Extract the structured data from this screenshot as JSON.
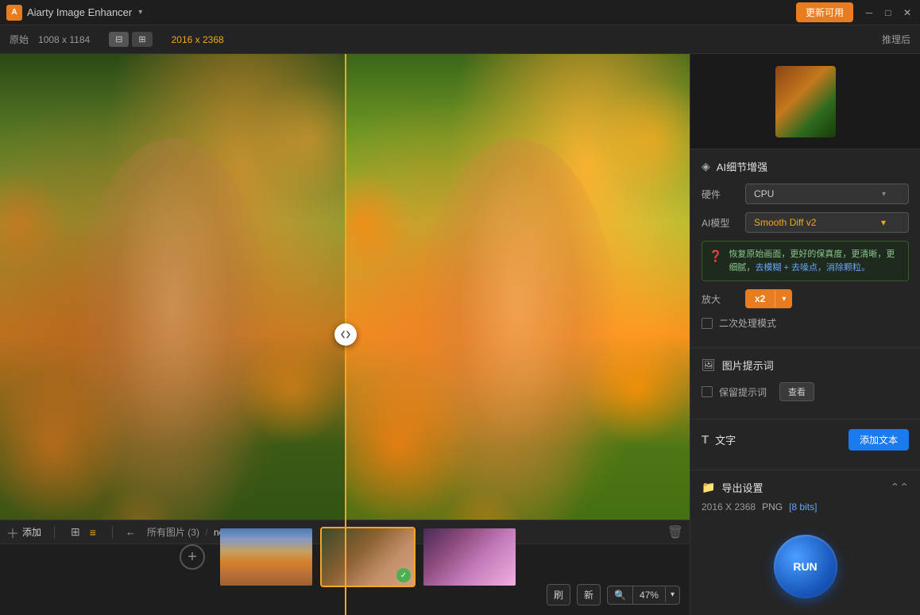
{
  "app": {
    "title": "Aiarty Image Enhancer",
    "update_btn": "更新可用",
    "logo_text": "A"
  },
  "toolbar": {
    "original_label": "原始",
    "input_dims": "1008 x 1184",
    "output_dims": "2016 x 2368",
    "inferred_label": "推理后",
    "zoom_value": "47%",
    "refresh_label": "刷",
    "new_label": "新"
  },
  "right_panel": {
    "ai_enhance_title": "AI细节增强",
    "hardware_label": "硬件",
    "hardware_value": "CPU",
    "ai_model_label": "AI模型",
    "ai_model_value": "Smooth Diff v2",
    "hint_text": "恢复原始画面，更好的保真度，更清晰，更细腻，去模糊 + 去噪点，消除颗粒。",
    "hint_highlight": "去模糊 + 去噪点，消除颗粒。",
    "scale_label": "放大",
    "scale_value": "x2",
    "secondary_process": "二次处理模式",
    "image_hint_title": "图片提示词",
    "keep_hint": "保留提示词",
    "view_btn": "查看",
    "text_title": "文字",
    "add_text_btn": "添加文本",
    "export_title": "导出设置",
    "export_dims": "2016 X 2368",
    "export_format": "PNG",
    "export_bits": "[8 bits]",
    "run_btn": "RUN"
  },
  "filmstrip": {
    "add_label": "添加",
    "all_images_label": "所有图片 (3)",
    "current_file": "noises.jpg",
    "breadcrumb_sep": "/",
    "items": [
      {
        "id": 1,
        "active": false,
        "type": "city"
      },
      {
        "id": 2,
        "active": true,
        "type": "woman",
        "checked": true
      },
      {
        "id": 3,
        "active": false,
        "type": "bird"
      }
    ]
  },
  "icons": {
    "ai_icon": "◈",
    "hardware_icon": "⚙",
    "image_hint_icon": "🖼",
    "text_icon": "T",
    "export_icon": "📁",
    "split_left": "◀",
    "split_right": "▶"
  }
}
